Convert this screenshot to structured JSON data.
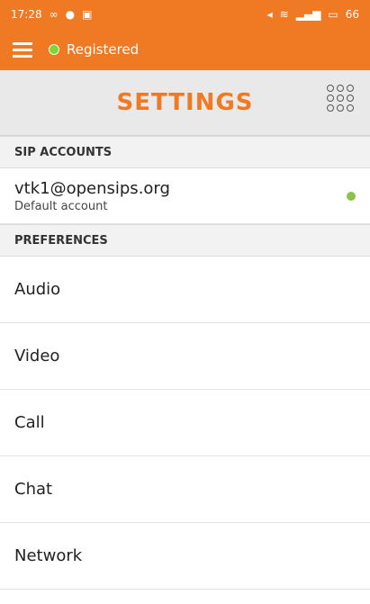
{
  "status_bar": {
    "time": "17:28",
    "battery": "66"
  },
  "toolbar": {
    "status_label": "Registered"
  },
  "title": {
    "text": "SETTINGS"
  },
  "sections": {
    "sip_accounts": "SIP ACCOUNTS",
    "preferences": "PREFERENCES"
  },
  "account": {
    "name": "vtk1@opensips.org",
    "subtitle": "Default account"
  },
  "preferences": [
    {
      "label": "Audio"
    },
    {
      "label": "Video"
    },
    {
      "label": "Call"
    },
    {
      "label": "Chat"
    },
    {
      "label": "Network"
    }
  ],
  "colors": {
    "accent": "#f07a24",
    "registered": "#7fd43b"
  },
  "icons": [
    "menu-icon",
    "registered-dot-icon",
    "dialpad-icon",
    "status-dot-icon"
  ]
}
